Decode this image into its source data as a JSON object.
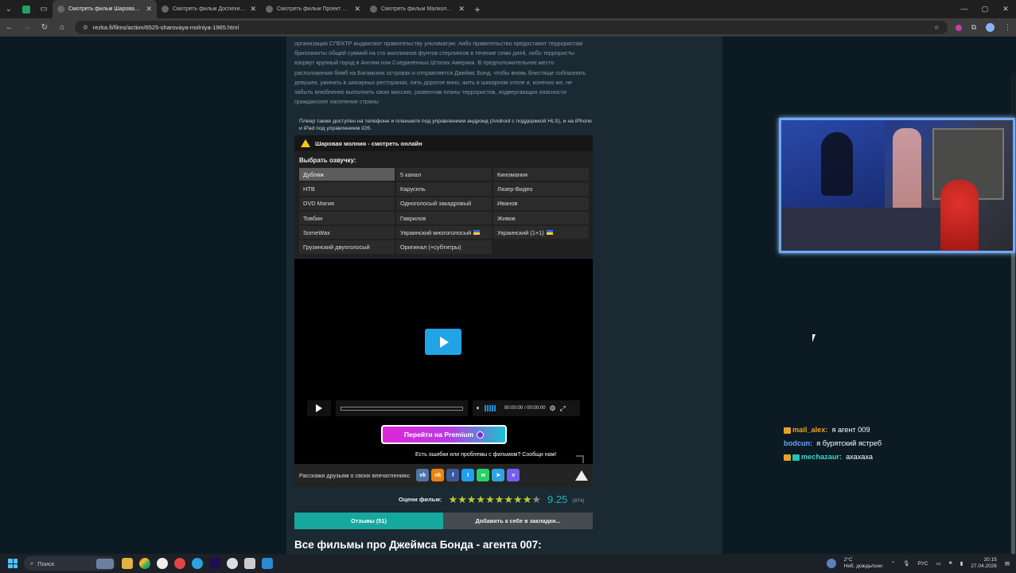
{
  "browser": {
    "tabs": [
      {
        "title": "Смотреть фильм Шаровая мо",
        "active": true
      },
      {
        "title": "Смотреть фильм Доспехи Бог",
        "active": false
      },
      {
        "title": "Смотреть фильм Проект «Аль",
        "active": false
      },
      {
        "title": "Смотреть фильм Малкольм И",
        "active": false
      }
    ],
    "url": "rezka.fi/films/action/6525-sharovaya-molniya-1965.html"
  },
  "description": "организации СПЕКТР выдвигают правительству ультиматум: либо правительство предоставит террористам бриллианты общей суммой на сто миллионов фунтов стерлингов в течение семи дней, либо террористы взорвут крупный город в Англии или Соединённых Штатах Америки. В предположительное место расположения бомб на Багамских островах и отправляется Джеймс Бонд, чтобы вновь блестяще соблазнять девушек, ужинать в шикарных ресторанах, пить дорогое вино, жить в шикарном отеле и, конечно же, не забыть влюбленно выполнить свою миссию, развенчав планы террористов, подвергающих опасности гражданское население страны",
  "player_notice": "Плеер также доступен на телефоне и планшете под управлением андроид (Android с поддержкой HLS), и на iPhone и iPad под управлением iOS.",
  "watch_title": "Шаровая молния - смотреть онлайн",
  "voice_label": "Выбрать озвучку:",
  "voices": [
    {
      "name": "Дубляж",
      "active": true,
      "flag": false
    },
    {
      "name": "5 канал",
      "active": false,
      "flag": false
    },
    {
      "name": "Киномания",
      "active": false,
      "flag": false
    },
    {
      "name": "НТВ",
      "active": false,
      "flag": false
    },
    {
      "name": "Карусель",
      "active": false,
      "flag": false
    },
    {
      "name": "Лазер-Видео",
      "active": false,
      "flag": false
    },
    {
      "name": "DVD Магия",
      "active": false,
      "flag": false
    },
    {
      "name": "Одноголосый закадровый",
      "active": false,
      "flag": false
    },
    {
      "name": "Иванов",
      "active": false,
      "flag": false
    },
    {
      "name": "Товбин",
      "active": false,
      "flag": false
    },
    {
      "name": "Гаврилов",
      "active": false,
      "flag": false
    },
    {
      "name": "Живов",
      "active": false,
      "flag": false
    },
    {
      "name": "SomeWax",
      "active": false,
      "flag": false
    },
    {
      "name": "Украинский многоголосый",
      "active": false,
      "flag": true
    },
    {
      "name": "Украинский (1+1)",
      "active": false,
      "flag": true
    },
    {
      "name": "Грузинский двухголосый",
      "active": false,
      "flag": false
    },
    {
      "name": "Оригинал (+субтитры)",
      "active": false,
      "flag": false
    }
  ],
  "player": {
    "time": "00:00:00 / 00:00:00",
    "progress": 0
  },
  "premium_label": "Перейти на Premium",
  "error_link": "Есть ошибки или проблемы с фильмом? Сообщи нам!",
  "share_label": "Расскажи друзьям о своих впечатлениях:",
  "share_icons": [
    {
      "name": "vk-icon",
      "glyph": "vk",
      "color": "#4c75a3"
    },
    {
      "name": "odnoklassniki-icon",
      "glyph": "ok",
      "color": "#ee8208"
    },
    {
      "name": "facebook-icon",
      "glyph": "f",
      "color": "#3b5998"
    },
    {
      "name": "twitter-icon",
      "glyph": "t",
      "color": "#1da1f2"
    },
    {
      "name": "whatsapp-icon",
      "glyph": "w",
      "color": "#25d366"
    },
    {
      "name": "telegram-icon",
      "glyph": "➤",
      "color": "#2ca5e0"
    },
    {
      "name": "viber-icon",
      "glyph": "v",
      "color": "#7360f2"
    }
  ],
  "rating": {
    "label": "Оцени фильм:",
    "score": "9.25",
    "votes": "(974)",
    "stars_filled": 9,
    "stars_total": 10
  },
  "reviews_tab": "Отзывы (51)",
  "bookmark_tab": "Добавить к себе в закладки...",
  "bond_title": "Все фильмы про Джеймса Бонда - агента 007:",
  "chat": [
    {
      "user": "mail_alex:",
      "color": "#e8a22a",
      "message": "я агент 009",
      "badge": true,
      "badge2": false
    },
    {
      "user": "bodcun:",
      "color": "#6aa5ff",
      "message": "я бурятский ястреб",
      "badge": false,
      "badge2": false
    },
    {
      "user": "mechazaur:",
      "color": "#3fd9c9",
      "message": "ахахаха",
      "badge": true,
      "badge2": true
    }
  ],
  "taskbar": {
    "search": "Поиск",
    "weather_temp": "2°C",
    "weather_desc": "Неб. дождь/снег",
    "lang": "РУС",
    "time": "20:15",
    "date": "27.04.2026"
  }
}
